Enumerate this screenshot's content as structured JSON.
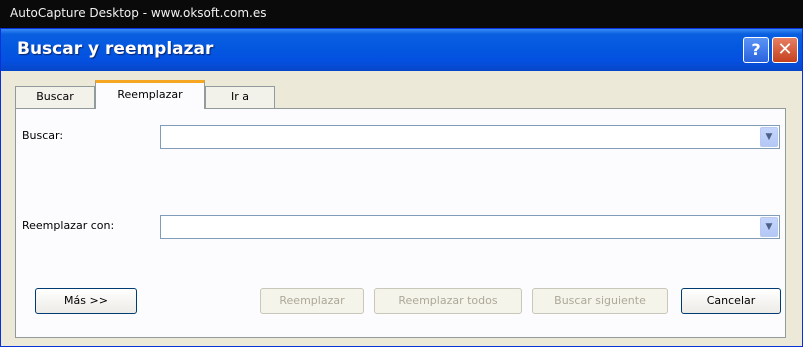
{
  "capture_bar": {
    "text": "AutoCapture Desktop - www.oksoft.com.es"
  },
  "window": {
    "title": "Buscar y reemplazar",
    "help_glyph": "?",
    "close_glyph": "✕"
  },
  "tabs": [
    {
      "label": "Buscar",
      "active": false
    },
    {
      "label": "Reemplazar",
      "active": true
    },
    {
      "label": "Ir a",
      "active": false
    }
  ],
  "fields": {
    "find": {
      "label": "Buscar:",
      "value": ""
    },
    "replace": {
      "label": "Reemplazar con:",
      "value": ""
    }
  },
  "combo_arrow_glyph": "▼",
  "buttons": {
    "more": "Más >>",
    "replace": "Reemplazar",
    "replace_all": "Reemplazar todos",
    "find_next": "Buscar siguiente",
    "cancel": "Cancelar"
  },
  "colors": {
    "titlebar": "#0358e0",
    "dialog_bg": "#ece9d8",
    "active_tab_accent": "#f5a623",
    "close_button": "#c4401f"
  }
}
